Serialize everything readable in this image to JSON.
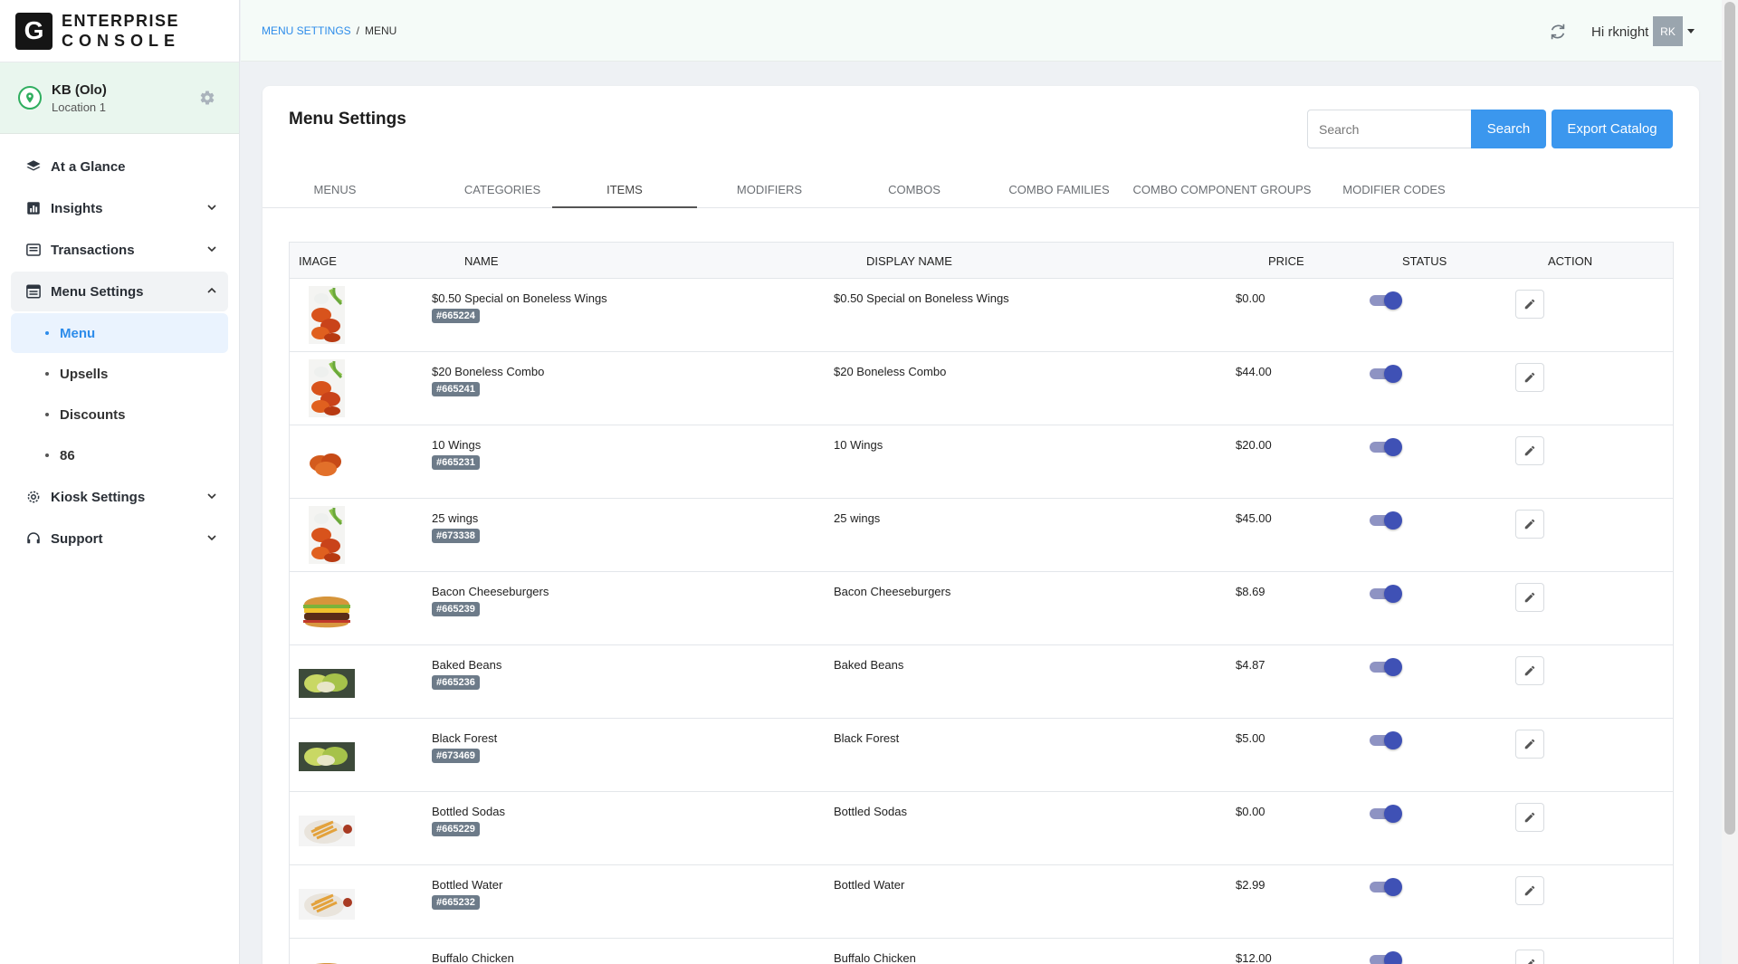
{
  "brand": {
    "logo_letter": "G",
    "line1": "ENTERPRISE",
    "line2": "CONSOLE"
  },
  "location": {
    "name": "KB (Olo)",
    "sub": "Location 1"
  },
  "nav": {
    "at_a_glance": "At a Glance",
    "insights": "Insights",
    "transactions": "Transactions",
    "menu_settings": "Menu Settings",
    "menu_sub": [
      "Menu",
      "Upsells",
      "Discounts",
      "86"
    ],
    "kiosk_settings": "Kiosk Settings",
    "support": "Support"
  },
  "breadcrumb": {
    "parent": "MENU SETTINGS",
    "separator": "/",
    "current": "MENU"
  },
  "header": {
    "greeting": "Hi rknight",
    "avatar": "RK"
  },
  "page": {
    "title": "Menu Settings",
    "search_placeholder": "Search",
    "search_button": "Search",
    "export_button": "Export Catalog"
  },
  "tabs": [
    "MENUS",
    "CATEGORIES",
    "ITEMS",
    "MODIFIERS",
    "COMBOS",
    "COMBO FAMILIES",
    "COMBO COMPONENT GROUPS",
    "MODIFIER CODES"
  ],
  "active_tab": "ITEMS",
  "table": {
    "headers": [
      "IMAGE",
      "NAME",
      "DISPLAY NAME",
      "PRICE",
      "STATUS",
      "ACTION"
    ],
    "rows": [
      {
        "name": "$0.50 Special on Boneless Wings",
        "sku": "#665224",
        "display": "$0.50 Special on Boneless Wings",
        "price": "$0.00",
        "image": "wings-icon",
        "status": true
      },
      {
        "name": "$20 Boneless Combo",
        "sku": "#665241",
        "display": "$20 Boneless Combo",
        "price": "$44.00",
        "image": "wings-icon",
        "status": true
      },
      {
        "name": "10 Wings",
        "sku": "#665231",
        "display": "10 Wings",
        "price": "$20.00",
        "image": "nuggets-icon",
        "status": true
      },
      {
        "name": "25 wings",
        "sku": "#673338",
        "display": "25 wings",
        "price": "$45.00",
        "image": "wings-icon",
        "status": true
      },
      {
        "name": "Bacon Cheeseburgers",
        "sku": "#665239",
        "display": "Bacon Cheeseburgers",
        "price": "$8.69",
        "image": "burger-icon",
        "status": true
      },
      {
        "name": "Baked Beans",
        "sku": "#665236",
        "display": "Baked Beans",
        "price": "$4.87",
        "image": "salad-icon",
        "status": true
      },
      {
        "name": "Black Forest",
        "sku": "#673469",
        "display": "Black Forest",
        "price": "$5.00",
        "image": "salad-icon",
        "status": true
      },
      {
        "name": "Bottled Sodas",
        "sku": "#665229",
        "display": "Bottled Sodas",
        "price": "$0.00",
        "image": "fries-icon",
        "status": true
      },
      {
        "name": "Bottled Water",
        "sku": "#665232",
        "display": "Bottled Water",
        "price": "$2.99",
        "image": "fries-icon",
        "status": true
      },
      {
        "name": "Buffalo Chicken",
        "sku": "",
        "display": "Buffalo Chicken",
        "price": "$12.00",
        "image": "burger-icon",
        "status": true
      }
    ]
  },
  "colors": {
    "accent": "#3b97ee",
    "toggle": "#3f51b5",
    "location_bg": "#e9f6ee"
  }
}
